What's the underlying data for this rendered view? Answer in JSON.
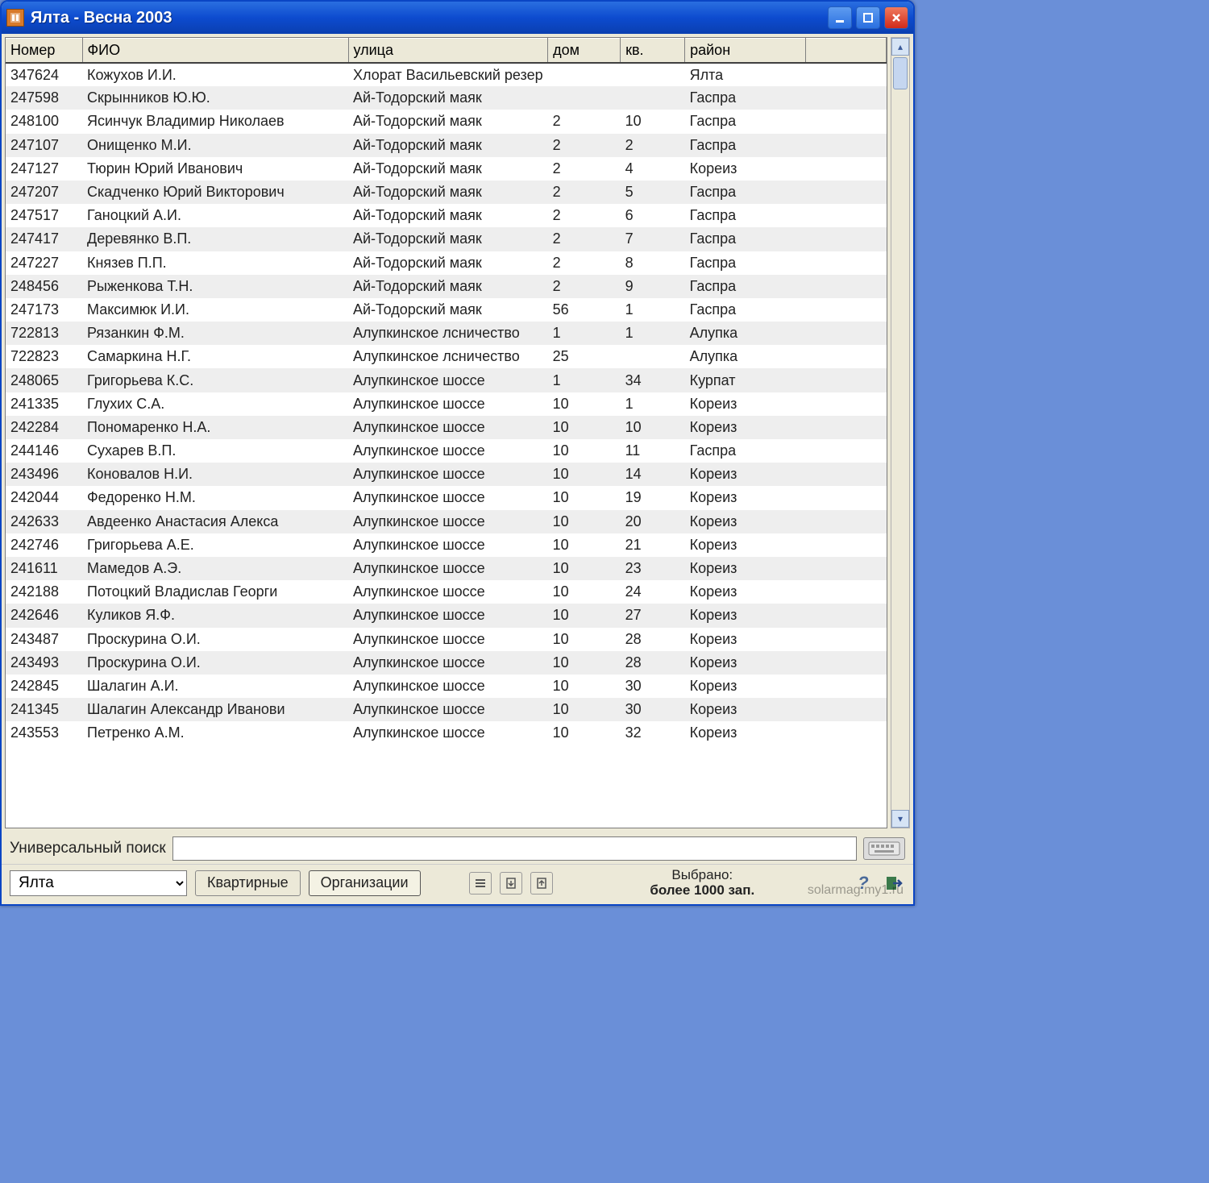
{
  "window": {
    "title": "Ялта  - Весна 2003"
  },
  "columns": {
    "number": "Номер",
    "name": "ФИО",
    "street": "улица",
    "house": "дом",
    "apt": "кв.",
    "district": "район"
  },
  "rows": [
    {
      "num": "347624",
      "name": "Кожухов И.И.",
      "street": "Хлорат Васильевский резер",
      "house": "",
      "apt": "",
      "district": "Ялта"
    },
    {
      "num": "247598",
      "name": "Скрынников Ю.Ю.",
      "street": "Ай-Тодорский маяк",
      "house": "",
      "apt": "",
      "district": "Гаспра"
    },
    {
      "num": "248100",
      "name": "Ясинчук Владимир Николаев",
      "street": "Ай-Тодорский маяк",
      "house": "2",
      "apt": "10",
      "district": "Гаспра"
    },
    {
      "num": "247107",
      "name": "Онищенко М.И.",
      "street": "Ай-Тодорский маяк",
      "house": "2",
      "apt": "2",
      "district": "Гаспра"
    },
    {
      "num": "247127",
      "name": "Тюрин Юрий Иванович",
      "street": "Ай-Тодорский маяк",
      "house": "2",
      "apt": "4",
      "district": "Кореиз"
    },
    {
      "num": "247207",
      "name": "Скадченко Юрий Викторович",
      "street": "Ай-Тодорский маяк",
      "house": "2",
      "apt": "5",
      "district": "Гаспра"
    },
    {
      "num": "247517",
      "name": "Ганоцкий А.И.",
      "street": "Ай-Тодорский маяк",
      "house": "2",
      "apt": "6",
      "district": "Гаспра"
    },
    {
      "num": "247417",
      "name": "Деревянко В.П.",
      "street": "Ай-Тодорский маяк",
      "house": "2",
      "apt": "7",
      "district": "Гаспра"
    },
    {
      "num": "247227",
      "name": "Князев П.П.",
      "street": "Ай-Тодорский маяк",
      "house": "2",
      "apt": "8",
      "district": "Гаспра"
    },
    {
      "num": "248456",
      "name": "Рыженкова Т.Н.",
      "street": "Ай-Тодорский маяк",
      "house": "2",
      "apt": "9",
      "district": "Гаспра"
    },
    {
      "num": "247173",
      "name": "Максимюк И.И.",
      "street": "Ай-Тодорский маяк",
      "house": "56",
      "apt": "1",
      "district": "Гаспра"
    },
    {
      "num": "722813",
      "name": "Рязанкин Ф.М.",
      "street": "Алупкинское лсничество",
      "house": "1",
      "apt": "1",
      "district": "Алупка"
    },
    {
      "num": "722823",
      "name": "Самаркина Н.Г.",
      "street": "Алупкинское лсничество",
      "house": "25",
      "apt": "",
      "district": "Алупка"
    },
    {
      "num": "248065",
      "name": "Григорьева К.С.",
      "street": "Алупкинское шоссе",
      "house": "1",
      "apt": "34",
      "district": "Курпат"
    },
    {
      "num": "241335",
      "name": "Глухих С.А.",
      "street": "Алупкинское шоссе",
      "house": "10",
      "apt": "1",
      "district": "Кореиз"
    },
    {
      "num": "242284",
      "name": "Пономаренко Н.А.",
      "street": "Алупкинское шоссе",
      "house": "10",
      "apt": "10",
      "district": "Кореиз"
    },
    {
      "num": "244146",
      "name": "Сухарев В.П.",
      "street": "Алупкинское шоссе",
      "house": "10",
      "apt": "11",
      "district": "Гаспра"
    },
    {
      "num": "243496",
      "name": "Коновалов Н.И.",
      "street": "Алупкинское шоссе",
      "house": "10",
      "apt": "14",
      "district": "Кореиз"
    },
    {
      "num": "242044",
      "name": "Федоренко Н.М.",
      "street": "Алупкинское шоссе",
      "house": "10",
      "apt": "19",
      "district": "Кореиз"
    },
    {
      "num": "242633",
      "name": "Авдеенко Анастасия Алекса",
      "street": "Алупкинское шоссе",
      "house": "10",
      "apt": "20",
      "district": "Кореиз"
    },
    {
      "num": "242746",
      "name": "Григорьева А.Е.",
      "street": "Алупкинское шоссе",
      "house": "10",
      "apt": "21",
      "district": "Кореиз"
    },
    {
      "num": "241611",
      "name": "Мамедов А.Э.",
      "street": "Алупкинское шоссе",
      "house": "10",
      "apt": "23",
      "district": "Кореиз"
    },
    {
      "num": "242188",
      "name": "Потоцкий Владислав Георги",
      "street": "Алупкинское шоссе",
      "house": "10",
      "apt": "24",
      "district": "Кореиз"
    },
    {
      "num": "242646",
      "name": "Куликов Я.Ф.",
      "street": "Алупкинское шоссе",
      "house": "10",
      "apt": "27",
      "district": "Кореиз"
    },
    {
      "num": "243487",
      "name": "Проскурина О.И.",
      "street": "Алупкинское шоссе",
      "house": "10",
      "apt": "28",
      "district": "Кореиз"
    },
    {
      "num": "243493",
      "name": "Проскурина О.И.",
      "street": "Алупкинское шоссе",
      "house": "10",
      "apt": "28",
      "district": "Кореиз"
    },
    {
      "num": "242845",
      "name": "Шалагин А.И.",
      "street": "Алупкинское шоссе",
      "house": "10",
      "apt": "30",
      "district": "Кореиз"
    },
    {
      "num": "241345",
      "name": "Шалагин Александр Иванови",
      "street": "Алупкинское шоссе",
      "house": "10",
      "apt": "30",
      "district": "Кореиз"
    },
    {
      "num": "243553",
      "name": "Петренко А.М.",
      "street": "Алупкинское шоссе",
      "house": "10",
      "apt": "32",
      "district": "Кореиз"
    }
  ],
  "search": {
    "label": "Универсальный поиск",
    "value": ""
  },
  "toolbar": {
    "city_selected": "Ялта",
    "btn_apartments": "Квартирные",
    "btn_orgs": "Организации",
    "status_line1": "Выбрано:",
    "status_line2": "более 1000 зап."
  },
  "watermark": "solarmag.my1.ru"
}
